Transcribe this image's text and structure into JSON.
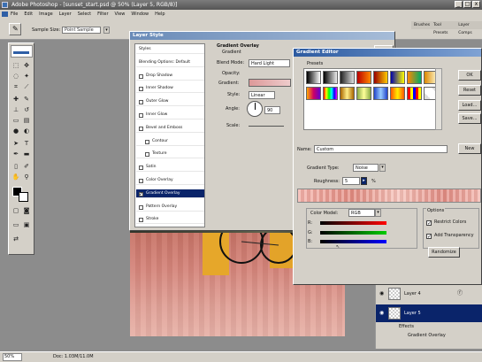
{
  "app": {
    "title": "Adobe Photoshop - [sunset_start.psd @ 50% (Layer 5, RGB/8)]",
    "menu": [
      "File",
      "Edit",
      "Image",
      "Layer",
      "Select",
      "Filter",
      "View",
      "Window",
      "Help"
    ],
    "window_controls": [
      "_",
      "□",
      "x"
    ]
  },
  "options_bar": {
    "sample_size_label": "Sample Size:",
    "sample_size_value": "Point Sample"
  },
  "palette_tabs": [
    "Brushes",
    "Tool Presets",
    "Layer Comps"
  ],
  "layer_style": {
    "title": "Layer Style",
    "list": [
      "Styles",
      "Blending Options: Default",
      "Drop Shadow",
      "Inner Shadow",
      "Outer Glow",
      "Inner Glow",
      "Bevel and Emboss",
      "Contour",
      "Texture",
      "Satin",
      "Color Overlay",
      "Gradient Overlay",
      "Pattern Overlay",
      "Stroke"
    ],
    "selected_index": 11,
    "section_title": "Gradient Overlay",
    "section_sub": "Gradient",
    "blend_mode_label": "Blend Mode:",
    "blend_mode_value": "Hard Light",
    "opacity_label": "Opacity:",
    "gradient_label": "Gradient:",
    "style_label": "Style:",
    "style_value": "Linear",
    "angle_label": "Angle:",
    "angle_value": "90",
    "scale_label": "Scale:",
    "ok_label": "OK"
  },
  "gradient_editor": {
    "title": "Gradient Editor",
    "presets_label": "Presets",
    "ok_label": "OK",
    "reset_label": "Reset",
    "load_label": "Load...",
    "save_label": "Save...",
    "name_label": "Name:",
    "name_value": "Custom",
    "new_label": "New",
    "gradient_type_label": "Gradient Type:",
    "gradient_type_value": "Noise",
    "roughness_label": "Roughness:",
    "roughness_value": "5",
    "roughness_unit": "%",
    "color_model_label": "Color Model:",
    "color_model_value": "RGB",
    "channel_labels": [
      "R:",
      "G:",
      "B:"
    ],
    "options_label": "Options",
    "restrict_colors_label": "Restrict Colors",
    "restrict_colors_checked": true,
    "add_transparency_label": "Add Transparency",
    "add_transparency_checked": true,
    "randomize_label": "Randomize"
  },
  "layers_panel": {
    "layers": [
      {
        "name": "Layer 4",
        "selected": false
      },
      {
        "name": "Layer 5",
        "selected": true
      }
    ],
    "effects_label": "Effects",
    "effect_item": "Gradient Overlay"
  },
  "status_bar": {
    "zoom": "50%",
    "doc": "Doc: 1.03M/11.0M"
  }
}
